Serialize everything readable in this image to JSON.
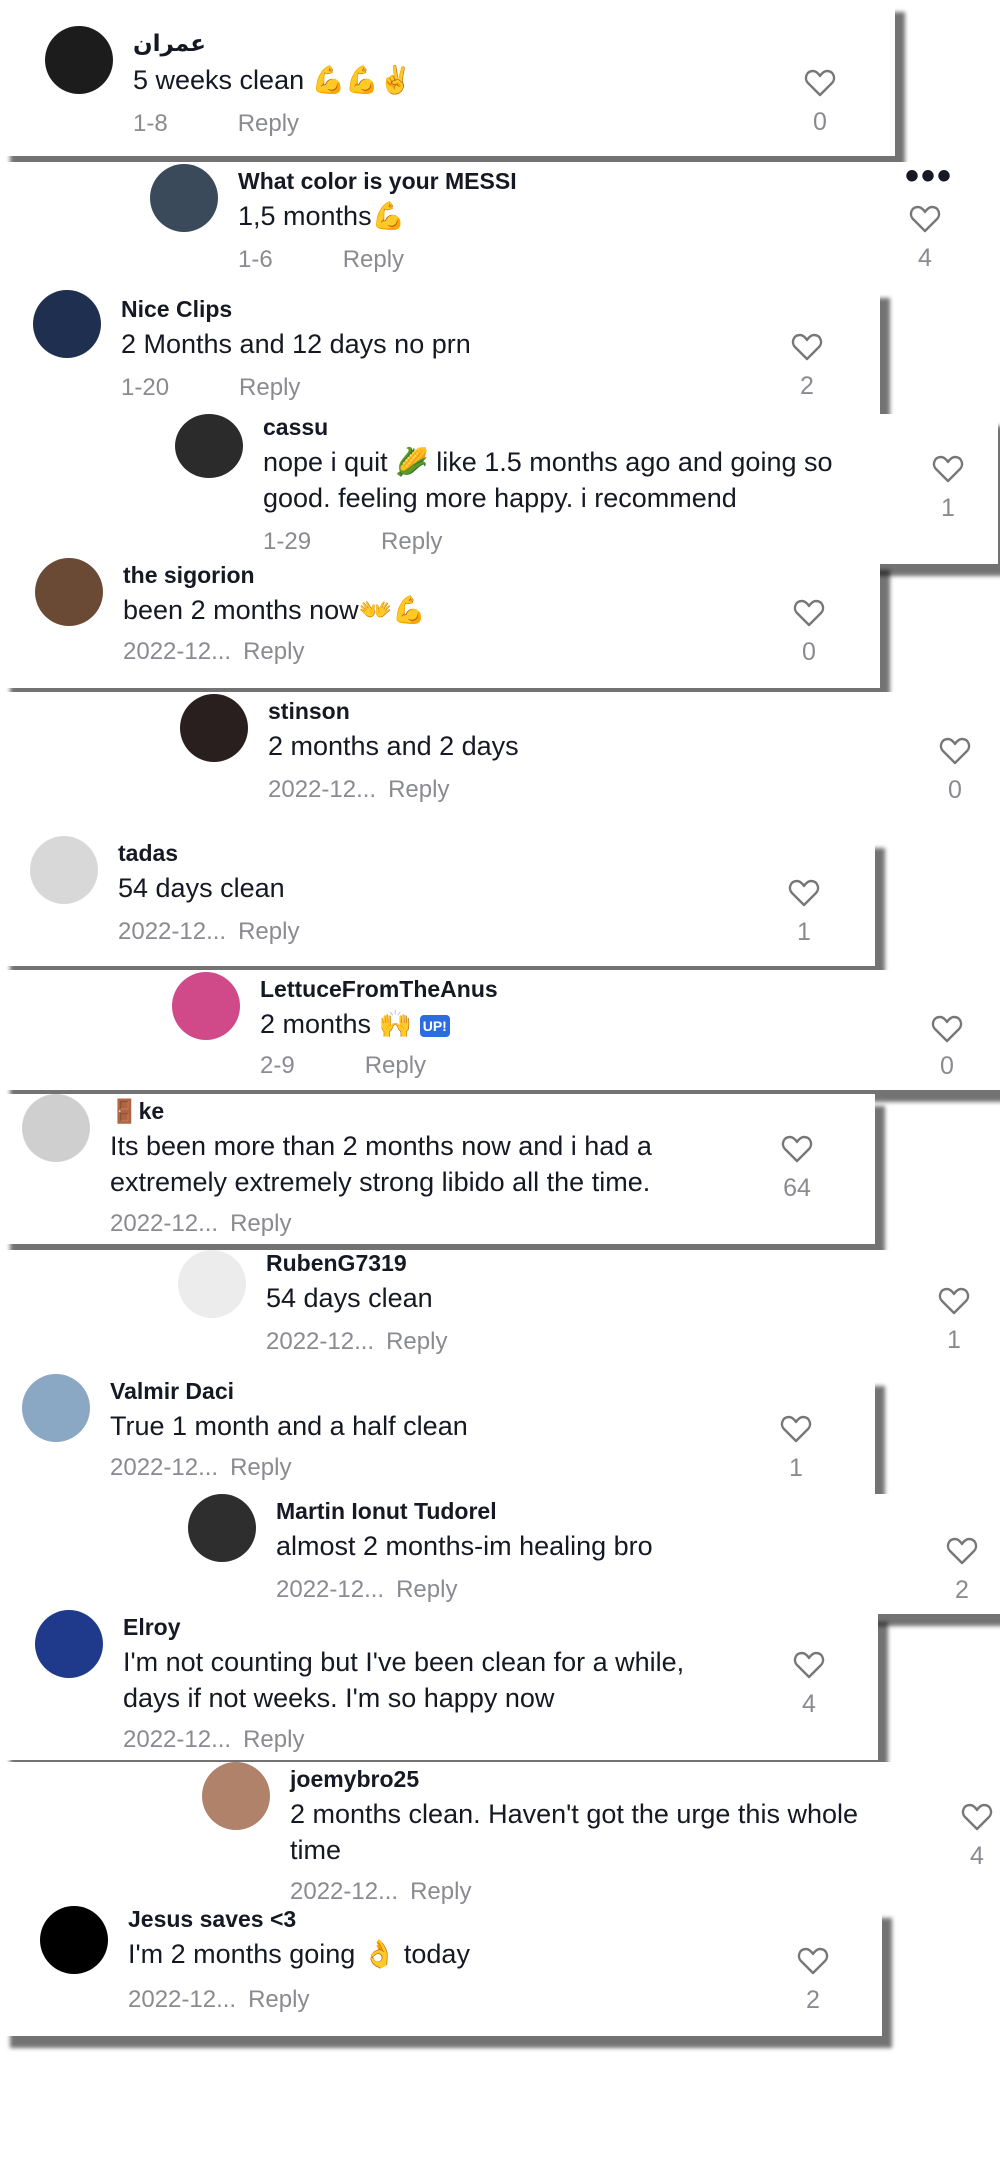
{
  "comments": [
    {
      "user": "عمران",
      "text": "5 weeks clean 💪💪✌️",
      "date": "1-8",
      "reply": "Reply",
      "likes": "0"
    },
    {
      "user": "What color is your MESSI",
      "text": "1,5 months💪",
      "date": "1-6",
      "reply": "Reply",
      "likes": "4",
      "more": "•••"
    },
    {
      "user": "Nice Clips",
      "text": "2 Months and 12 days no prn",
      "date": "1-20",
      "reply": "Reply",
      "likes": "2"
    },
    {
      "user": "cassu",
      "text": "nope i quit 🌽 like 1.5 months ago and going so good. feeling more happy. i recommend",
      "date": "1-29",
      "reply": "Reply",
      "likes": "1"
    },
    {
      "user": "the sigorion",
      "text": "been 2 months now👐💪",
      "date": "2022-12...",
      "reply": "Reply",
      "likes": "0"
    },
    {
      "user": "stinson",
      "text": "2 months and 2 days",
      "date": "2022-12...",
      "reply": "Reply",
      "likes": "0"
    },
    {
      "user": "tadas",
      "text": "54 days clean",
      "date": "2022-12...",
      "reply": "Reply",
      "likes": "1"
    },
    {
      "user": "LettuceFromTheAnus",
      "text": "2 months 🙌",
      "badge": "UP!",
      "date": "2-9",
      "reply": "Reply",
      "likes": "0"
    },
    {
      "user": "🚪ke",
      "text": "Its been more than 2 months now and i had a extremely extremely strong libido all the time.",
      "date": "2022-12...",
      "reply": "Reply",
      "likes": "64"
    },
    {
      "user": "RubenG7319",
      "text": "54 days clean",
      "date": "2022-12...",
      "reply": "Reply",
      "likes": "1"
    },
    {
      "user": "Valmir Daci",
      "text": "True 1 month and a half clean",
      "date": "2022-12...",
      "reply": "Reply",
      "likes": "1"
    },
    {
      "user": "Martin Ionut Tudorel",
      "text": "almost 2 months-im healing bro",
      "date": "2022-12...",
      "reply": "Reply",
      "likes": "2"
    },
    {
      "user": "Elroy",
      "text": "I'm not counting but I've been clean for a while, days if not weeks. I'm so happy now",
      "date": "2022-12...",
      "reply": "Reply",
      "likes": "4"
    },
    {
      "user": "joemybro25",
      "text": "2 months clean. Haven't got the urge this whole time",
      "date": "2022-12...",
      "reply": "Reply",
      "likes": "4"
    },
    {
      "user": "Jesus saves <3",
      "text": "I'm 2 months going 👌 today",
      "date": "2022-12...",
      "reply": "Reply",
      "likes": "2"
    }
  ]
}
